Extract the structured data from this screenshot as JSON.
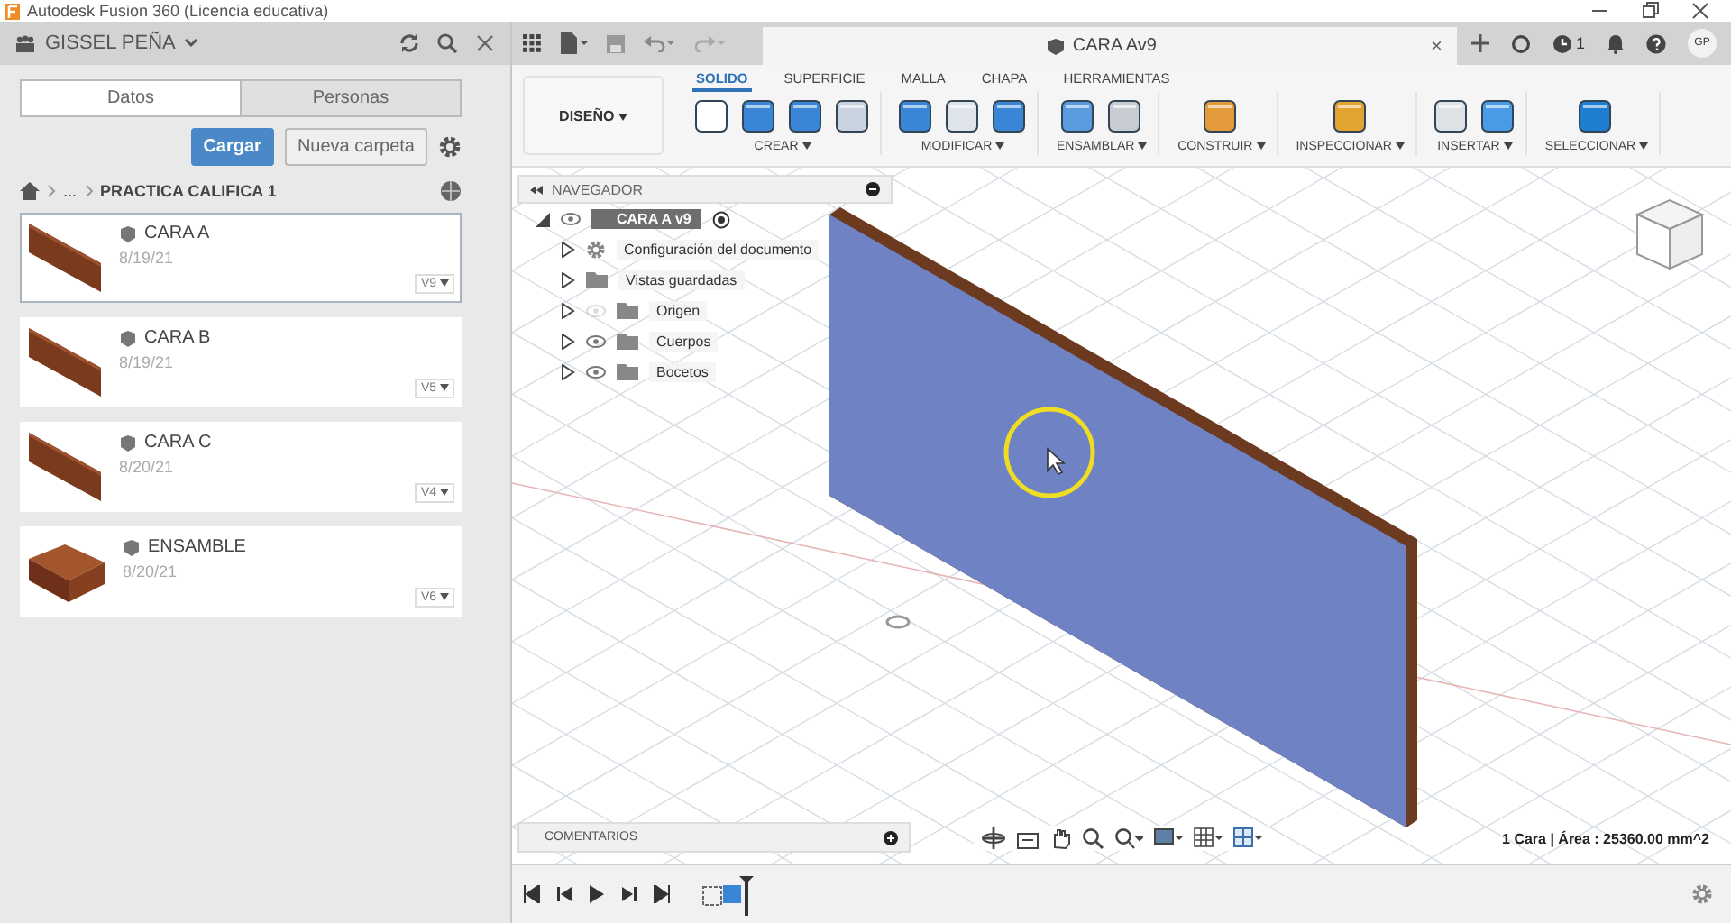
{
  "window": {
    "title": "Autodesk Fusion 360 (Licencia educativa)"
  },
  "data_panel": {
    "user": "GISSEL PEÑA",
    "tabs": [
      {
        "label": "Datos",
        "selected": true
      },
      {
        "label": "Personas",
        "selected": false
      }
    ],
    "upload_button": "Cargar",
    "new_folder_button": "Nueva carpeta",
    "breadcrumb": {
      "ellipsis": "...",
      "folder": "PRACTICA CALIFICA 1"
    },
    "files": [
      {
        "name": "CARA A",
        "date": "8/19/21",
        "version": "V9",
        "selected": true,
        "kind": "panel"
      },
      {
        "name": "CARA B",
        "date": "8/19/21",
        "version": "V5",
        "selected": false,
        "kind": "panel"
      },
      {
        "name": "CARA C",
        "date": "8/20/21",
        "version": "V4",
        "selected": false,
        "kind": "panel"
      },
      {
        "name": "ENSAMBLE",
        "date": "8/20/21",
        "version": "V6",
        "selected": false,
        "kind": "box"
      }
    ]
  },
  "document_tab": {
    "title": "CARA Av9",
    "close": "×"
  },
  "header_right": {
    "jobs_count": "1",
    "user_initials": "GP"
  },
  "toolbar": {
    "workspace": "DISEÑO",
    "tabs": [
      {
        "label": "SOLIDO",
        "selected": true
      },
      {
        "label": "SUPERFICIE",
        "selected": false
      },
      {
        "label": "MALLA",
        "selected": false
      },
      {
        "label": "CHAPA",
        "selected": false
      },
      {
        "label": "HERRAMIENTAS",
        "selected": false
      }
    ],
    "groups": [
      {
        "label": "CREAR"
      },
      {
        "label": "MODIFICAR"
      },
      {
        "label": "ENSAMBLAR"
      },
      {
        "label": "CONSTRUIR"
      },
      {
        "label": "INSPECCIONAR"
      },
      {
        "label": "INSERTAR"
      },
      {
        "label": "SELECCIONAR"
      }
    ]
  },
  "browser": {
    "title": "NAVEGADOR",
    "root": {
      "label": "CARA  A v9",
      "expanded": true,
      "children": [
        {
          "label": "Configuración del documento",
          "kind": "settings",
          "expanded": false
        },
        {
          "label": "Vistas guardadas",
          "kind": "views",
          "expanded": false
        },
        {
          "label": "Origen",
          "kind": "folder",
          "visible": false,
          "expanded": false
        },
        {
          "label": "Cuerpos",
          "kind": "folder",
          "visible": true,
          "expanded": false
        },
        {
          "label": "Bocetos",
          "kind": "folder",
          "visible": true,
          "expanded": false
        }
      ]
    }
  },
  "comments": {
    "title": "COMENTARIOS"
  },
  "status_bar": {
    "selection": "1 Cara | Área : 25360.00 mm^2"
  }
}
